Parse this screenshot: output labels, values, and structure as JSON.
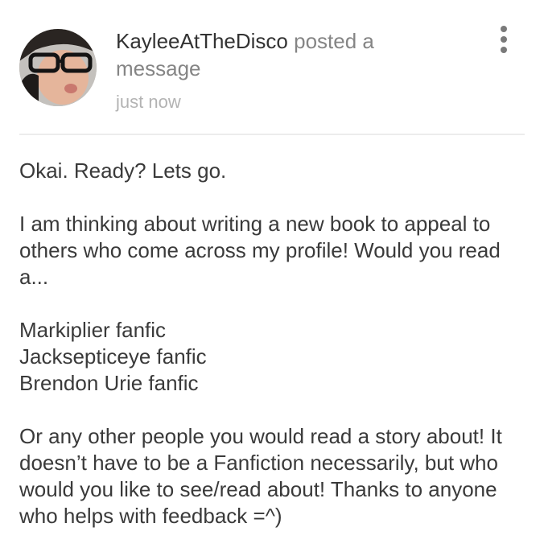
{
  "post": {
    "author": "KayleeAtTheDisco",
    "action": "posted a message",
    "timestamp": "just now"
  },
  "message": {
    "greeting": "Okai. Ready? Lets go.",
    "intro": "I am thinking about writing a new book to appeal to others who come across my profile! Would you read a...",
    "options": [
      "Markiplier fanfic",
      "Jacksepticeye fanfic",
      "Brendon Urie fanfic"
    ],
    "outro": "Or any other people you would read a story about! It doesn’t have to be a Fanfiction necessarily, but who would you like to see/read about! Thanks to anyone who helps with feedback =^)"
  },
  "icons": {
    "menu": "more-vertical-icon",
    "avatar": "user-avatar"
  }
}
